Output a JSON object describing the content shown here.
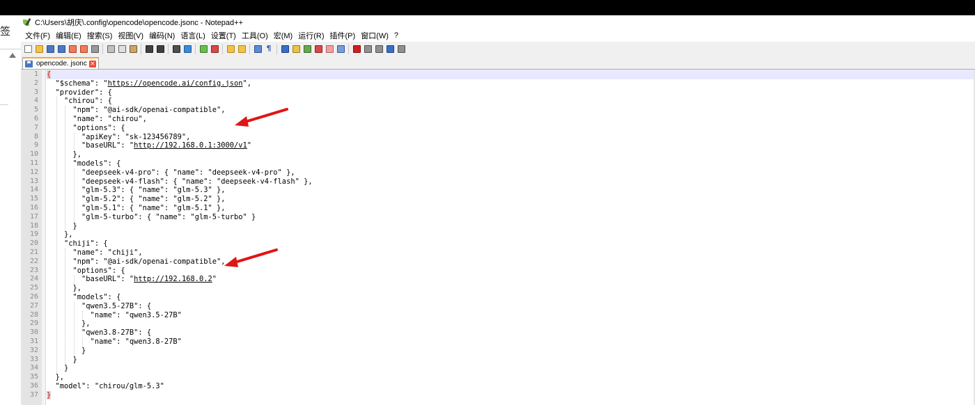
{
  "left_pane": {
    "glyph": "签"
  },
  "window": {
    "title": "C:\\Users\\胡庆\\.config\\opencode\\opencode.jsonc - Notepad++"
  },
  "menu": [
    "文件(F)",
    "编辑(E)",
    "搜索(S)",
    "视图(V)",
    "编码(N)",
    "语言(L)",
    "设置(T)",
    "工具(O)",
    "宏(M)",
    "运行(R)",
    "插件(P)",
    "窗口(W)",
    "?"
  ],
  "toolbar": {
    "buttons": [
      {
        "name": "new-file-icon",
        "color": "#ffffff",
        "border": "#777777"
      },
      {
        "name": "open-file-icon",
        "color": "#f2c14e",
        "border": "#b8860b"
      },
      {
        "name": "save-icon",
        "color": "#4a78c4",
        "border": "#2d4f8f"
      },
      {
        "name": "save-all-icon",
        "color": "#4a78c4",
        "border": "#2d4f8f"
      },
      {
        "name": "close-file-icon",
        "color": "#f07a5a",
        "border": "#b04020"
      },
      {
        "name": "close-all-icon",
        "color": "#f07a5a",
        "border": "#b04020"
      },
      {
        "name": "print-icon",
        "color": "#9a9a9a",
        "border": "#555555"
      },
      {
        "sep": true
      },
      {
        "name": "cut-icon",
        "color": "#c0c0c0",
        "border": "#666666"
      },
      {
        "name": "copy-icon",
        "color": "#e0e0e0",
        "border": "#666666"
      },
      {
        "name": "paste-icon",
        "color": "#c9a66b",
        "border": "#7a5a2a"
      },
      {
        "sep": true
      },
      {
        "name": "undo-icon",
        "color": "#404040",
        "border": "#202020"
      },
      {
        "name": "redo-icon",
        "color": "#404040",
        "border": "#202020"
      },
      {
        "sep": true
      },
      {
        "name": "find-icon",
        "color": "#505050",
        "border": "#202020"
      },
      {
        "name": "replace-icon",
        "color": "#3a8ad8",
        "border": "#1d5a9a"
      },
      {
        "sep": true
      },
      {
        "name": "zoom-in-icon",
        "color": "#6abf4b",
        "border": "#3a7a2a"
      },
      {
        "name": "zoom-out-icon",
        "color": "#d84a4a",
        "border": "#8a2020"
      },
      {
        "sep": true
      },
      {
        "name": "sync-vertical-icon",
        "color": "#f2c14e",
        "border": "#b8860b"
      },
      {
        "name": "sync-horizontal-icon",
        "color": "#f2c14e",
        "border": "#b8860b"
      },
      {
        "sep": true
      },
      {
        "name": "word-wrap-icon",
        "color": "#5b8ad6",
        "border": "#2d4f8f"
      },
      {
        "name": "show-all-chars-icon",
        "glyph": "¶"
      },
      {
        "sep": true
      },
      {
        "name": "indent-guide-icon",
        "color": "#3a6fc9",
        "border": "#1d3f8a"
      },
      {
        "name": "user-language-icon",
        "color": "#e8c34a",
        "border": "#a07a10"
      },
      {
        "name": "document-map-icon",
        "color": "#6aa84f",
        "border": "#3a6a2a"
      },
      {
        "name": "function-list-icon",
        "color": "#d84a4a",
        "border": "#8a2020"
      },
      {
        "name": "folder-as-workspace-icon",
        "color": "#f0a0a0",
        "border": "#b06060"
      },
      {
        "name": "monitoring-icon",
        "color": "#7a9ad8",
        "border": "#3a5a9a"
      },
      {
        "sep": true
      },
      {
        "name": "record-macro-icon",
        "color": "#d02020",
        "border": "#801010"
      },
      {
        "name": "stop-recording-icon",
        "color": "#909090",
        "border": "#505050"
      },
      {
        "name": "play-macro-icon",
        "color": "#909090",
        "border": "#505050"
      },
      {
        "name": "run-macro-multiple-icon",
        "color": "#3a6fc9",
        "border": "#1d3f8a"
      },
      {
        "name": "save-macro-icon",
        "color": "#909090",
        "border": "#505050"
      }
    ]
  },
  "tab": {
    "label": "opencode. jsonc",
    "close": "×"
  },
  "editor": {
    "line_numbers": [
      "1",
      "2",
      "3",
      "4",
      "5",
      "6",
      "7",
      "8",
      "9",
      "10",
      "11",
      "12",
      "13",
      "14",
      "15",
      "16",
      "17",
      "18",
      "19",
      "20",
      "21",
      "22",
      "23",
      "24",
      "25",
      "26",
      "27",
      "28",
      "29",
      "30",
      "31",
      "32",
      "33",
      "34",
      "35",
      "36",
      "37"
    ],
    "lines": [
      "{",
      "  \"$schema\": \"https://opencode.ai/config.json\",",
      "  \"provider\": {",
      "    \"chirou\": {",
      "      \"npm\": \"@ai-sdk/openai-compatible\",",
      "      \"name\": \"chirou\",",
      "      \"options\": {",
      "        \"apiKey\": \"sk-123456789\",",
      "        \"baseURL\": \"http://192.168.0.1:3000/v1\"",
      "      },",
      "      \"models\": {",
      "        \"deepseek-v4-pro\": { \"name\": \"deepseek-v4-pro\" },",
      "        \"deepseek-v4-flash\": { \"name\": \"deepseek-v4-flash\" },",
      "        \"glm-5.3\": { \"name\": \"glm-5.3\" },",
      "        \"glm-5.2\": { \"name\": \"glm-5.2\" },",
      "        \"glm-5.1\": { \"name\": \"glm-5.1\" },",
      "        \"glm-5-turbo\": { \"name\": \"glm-5-turbo\" }",
      "      }",
      "    },",
      "    \"chiji\": {",
      "      \"name\": \"chiji\",",
      "      \"npm\": \"@ai-sdk/openai-compatible\",",
      "      \"options\": {",
      "        \"baseURL\": \"http://192.168.0.2\"",
      "      },",
      "      \"models\": {",
      "        \"qwen3.5-27B\": {",
      "          \"name\": \"qwen3.5-27B\"",
      "        },",
      "        \"qwen3.8-27B\": {",
      "          \"name\": \"qwen3.8-27B\"",
      "        }",
      "      }",
      "    }",
      "  },",
      "  \"model\": \"chirou/glm-5.3\"",
      "}"
    ],
    "urls": [
      "https://opencode.ai/config.json",
      "http://192.168.0.1:3000/v1",
      "http://192.168.0.2"
    ],
    "brace_highlight_color": "#e00000",
    "current_line_color": "#e8e8ff"
  },
  "annotation_color": "#e01515"
}
